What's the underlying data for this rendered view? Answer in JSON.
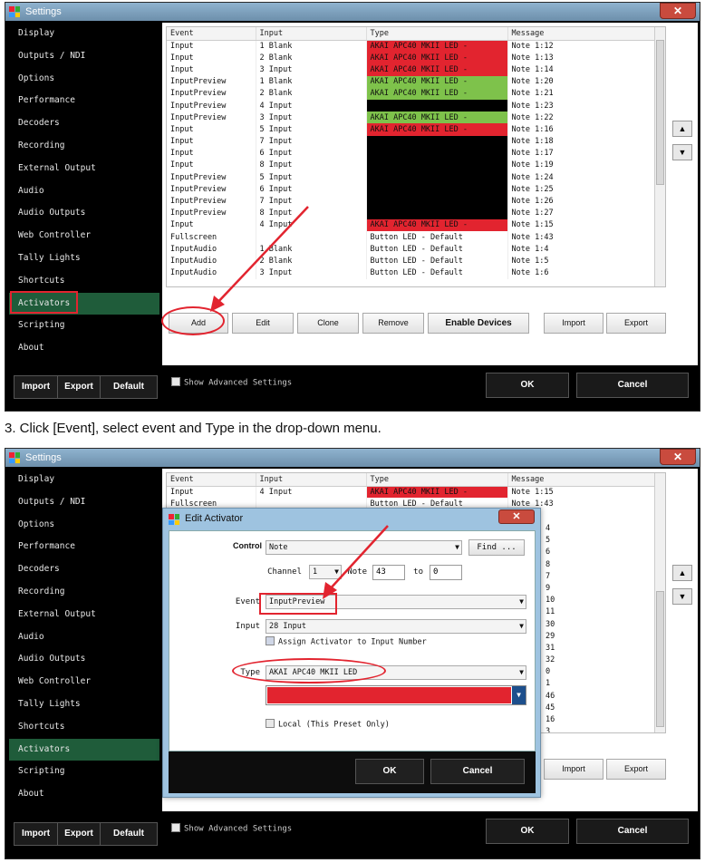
{
  "window": {
    "title": "Settings"
  },
  "sidebar": {
    "items": [
      "Display",
      "Outputs / NDI",
      "Options",
      "Performance",
      "Decoders",
      "Recording",
      "External Output",
      "Audio",
      "Audio Outputs",
      "Web Controller",
      "Tally Lights",
      "Shortcuts",
      "Activators",
      "Scripting",
      "About"
    ],
    "active": "Activators"
  },
  "grid": {
    "columns": [
      "Event",
      "Input",
      "Type",
      "Message"
    ],
    "rows": [
      {
        "event": "Input",
        "input": "1 Blank",
        "type": "AKAI APC40 MKII LED -",
        "style": "red",
        "message": "Note 1:12"
      },
      {
        "event": "Input",
        "input": "2 Blank",
        "type": "AKAI APC40 MKII LED -",
        "style": "red",
        "message": "Note 1:13"
      },
      {
        "event": "Input",
        "input": "3 Input",
        "type": "AKAI APC40 MKII LED -",
        "style": "red",
        "message": "Note 1:14"
      },
      {
        "event": "InputPreview",
        "input": "1 Blank",
        "type": "AKAI APC40 MKII LED -",
        "style": "green",
        "message": "Note 1:20"
      },
      {
        "event": "InputPreview",
        "input": "2 Blank",
        "type": "AKAI APC40 MKII LED -",
        "style": "green",
        "message": "Note 1:21"
      },
      {
        "event": "InputPreview",
        "input": "4 Input",
        "type": "",
        "style": "black",
        "message": "Note 1:23"
      },
      {
        "event": "InputPreview",
        "input": "3 Input",
        "type": "AKAI APC40 MKII LED -",
        "style": "green",
        "message": "Note 1:22"
      },
      {
        "event": "Input",
        "input": "5 Input",
        "type": "AKAI APC40 MKII LED -",
        "style": "red",
        "message": "Note 1:16"
      },
      {
        "event": "Input",
        "input": "7 Input",
        "type": "",
        "style": "black",
        "message": "Note 1:18"
      },
      {
        "event": "Input",
        "input": "6 Input",
        "type": "",
        "style": "black",
        "message": "Note 1:17"
      },
      {
        "event": "Input",
        "input": "8 Input",
        "type": "",
        "style": "black",
        "message": "Note 1:19"
      },
      {
        "event": "InputPreview",
        "input": "5 Input",
        "type": "",
        "style": "black",
        "message": "Note 1:24"
      },
      {
        "event": "InputPreview",
        "input": "6 Input",
        "type": "",
        "style": "black",
        "message": "Note 1:25"
      },
      {
        "event": "InputPreview",
        "input": "7 Input",
        "type": "",
        "style": "black",
        "message": "Note 1:26"
      },
      {
        "event": "InputPreview",
        "input": "8 Input",
        "type": "",
        "style": "black",
        "message": "Note 1:27"
      },
      {
        "event": "Input",
        "input": "4 Input",
        "type": "AKAI APC40 MKII LED -",
        "style": "red",
        "message": "Note 1:15"
      },
      {
        "event": "Fullscreen",
        "input": "",
        "type": "Button LED - Default",
        "style": "none",
        "message": "Note 1:43"
      },
      {
        "event": "InputAudio",
        "input": "1 Blank",
        "type": "Button LED - Default",
        "style": "none",
        "message": "Note 1:4"
      },
      {
        "event": "InputAudio",
        "input": "2 Blank",
        "type": "Button LED - Default",
        "style": "none",
        "message": "Note 1:5"
      },
      {
        "event": "InputAudio",
        "input": "3 Input",
        "type": "Button LED - Default",
        "style": "none",
        "message": "Note 1:6"
      }
    ]
  },
  "buttons": {
    "add": "Add",
    "edit": "Edit",
    "clone": "Clone",
    "remove": "Remove",
    "enable_devices": "Enable Devices",
    "import": "Import",
    "export": "Export"
  },
  "footer": {
    "import": "Import",
    "export": "Export",
    "default": "Default",
    "show_advanced": "Show Advanced Settings",
    "ok": "OK",
    "cancel": "Cancel"
  },
  "instruction": "3.  Click [Event], select event and Type in the drop-down menu.",
  "bg_grid": {
    "rows": [
      {
        "event": "Input",
        "input": "4 Input",
        "type": "AKAI APC40 MKII LED -",
        "message": "Note 1:15"
      },
      {
        "event": "Fullscreen",
        "input": "",
        "type": "Button LED - Default",
        "message": "Note 1:43"
      }
    ],
    "right_fragments": [
      "4",
      "5",
      "6",
      "8",
      "7",
      "9",
      "10",
      "11",
      "30",
      "29",
      "31",
      "32",
      "0",
      "1",
      "46",
      "45",
      "16",
      "3"
    ]
  },
  "dialog": {
    "title": "Edit Activator",
    "control_label": "Control",
    "control_value": "Note",
    "find": "Find ...",
    "channel_label": "Channel",
    "channel_value": "1",
    "note_label": "Note",
    "note_from": "43",
    "to_label": "to",
    "note_to": "0",
    "event_label": "Event",
    "event_value": "InputPreview",
    "input_label": "Input",
    "input_value": "28 Input",
    "assign_label": "Assign Activator to Input Number",
    "type_label": "Type",
    "type_value": "AKAI APC40 MKII LED",
    "local_label": "Local (This Preset Only)",
    "ok": "OK",
    "cancel": "Cancel",
    "color_swatch": "#e2242f"
  },
  "colors": {
    "accent_red": "#e2242f",
    "led_green": "#7ec24b",
    "sidebar_active": "#1f5c3a"
  }
}
